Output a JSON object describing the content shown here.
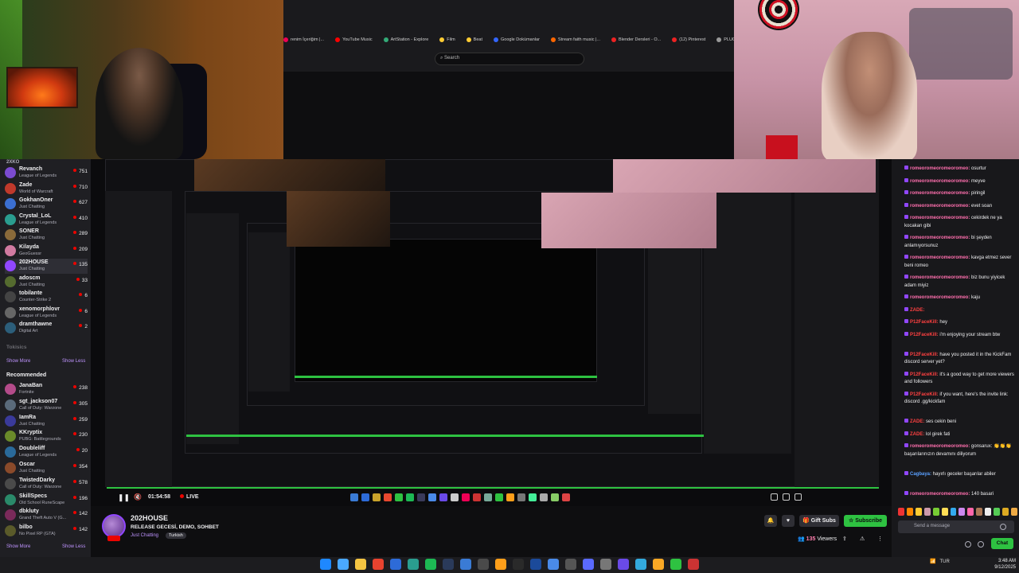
{
  "browser": {
    "bookmarks": [
      "renim İçeriğim |...",
      "YouTube Music",
      "ArtStation - Explore",
      "Film",
      "Beat",
      "Google Dokümanlar",
      "Stream faith music |...",
      "Blender Dersleri - O...",
      "(12) Pinterest",
      "PLUGI"
    ],
    "search_placeholder": "Search"
  },
  "sidebar": {
    "top_label": "2XKO",
    "followed": [
      {
        "name": "Revanch",
        "game": "League of Legends",
        "viewers": "751",
        "color": "#7b4bd0"
      },
      {
        "name": "Zade",
        "game": "World of Warcraft",
        "viewers": "710",
        "color": "#c0392b"
      },
      {
        "name": "GokhanOner",
        "game": "Just Chatting",
        "viewers": "627",
        "color": "#3b6fd1"
      },
      {
        "name": "Crystal_LoL",
        "game": "League of Legends",
        "viewers": "410",
        "color": "#2a9d8f"
      },
      {
        "name": "SONER",
        "game": "Just Chatting",
        "viewers": "289",
        "color": "#8a6a3a"
      },
      {
        "name": "Kilayda",
        "game": "GeoGuessr",
        "viewers": "209",
        "color": "#d17aa0"
      },
      {
        "name": "202HOUSE",
        "game": "Just Chatting",
        "viewers": "135",
        "color": "#9147ff"
      },
      {
        "name": "adoscm",
        "game": "Just Chatting",
        "viewers": "33",
        "color": "#556b2f"
      },
      {
        "name": "tobilante",
        "game": "Counter-Strike 2",
        "viewers": "6",
        "color": "#444"
      },
      {
        "name": "xenomorphlovr",
        "game": "League of Legends",
        "viewers": "6",
        "color": "#666"
      },
      {
        "name": "dramthawne",
        "game": "Digital Art",
        "viewers": "2",
        "color": "#2c5e7a"
      }
    ],
    "offline": "Tokisics",
    "show_more": "Show More",
    "show_less": "Show Less",
    "recommended_title": "Recommended",
    "recommended": [
      {
        "name": "JanaBan",
        "game": "Fortnite",
        "viewers": "238",
        "color": "#b44b8a"
      },
      {
        "name": "sgt_jackson07",
        "game": "Call of Duty: Warzone",
        "viewers": "305",
        "color": "#5a6a7a"
      },
      {
        "name": "IamRa",
        "game": "Just Chatting",
        "viewers": "259",
        "color": "#3a3a9a"
      },
      {
        "name": "KKryptix",
        "game": "PUBG: Battlegrounds",
        "viewers": "230",
        "color": "#6a8a2a"
      },
      {
        "name": "Doubleliff",
        "game": "League of Legends",
        "viewers": "20",
        "color": "#2a6a9a"
      },
      {
        "name": "Oscar",
        "game": "Just Chatting",
        "viewers": "354",
        "color": "#8a4a2a"
      },
      {
        "name": "TwistedDarky",
        "game": "Call of Duty: Warzone",
        "viewers": "578",
        "color": "#4a4a4a"
      },
      {
        "name": "SkillSpecs",
        "game": "Old School RuneScape",
        "viewers": "196",
        "color": "#2a8a6a"
      },
      {
        "name": "dbkluty",
        "game": "Grand Theft Auto V (G...",
        "viewers": "142",
        "color": "#7a2a5a"
      },
      {
        "name": "bilbo",
        "game": "No Pixel RP (GTA)",
        "viewers": "142",
        "color": "#5a5a2a"
      }
    ]
  },
  "player": {
    "time": "01:54:58",
    "live": "LIVE"
  },
  "stream": {
    "streamer": "202HOUSE",
    "title": "RELEASE GECESİ, DEMO, SOHBET",
    "category": "Just Chatting",
    "tag": "Turkish",
    "gift_label": "Gift Subs",
    "subscribe_label": "Subscribe",
    "viewers": "135",
    "viewers_label": "Viewers"
  },
  "chat": {
    "messages": [
      {
        "user": "romeoromeoromeoromeo:",
        "text": " osurtur",
        "cls": ""
      },
      {
        "user": "romeoromeoromeoromeo:",
        "text": " meyve",
        "cls": ""
      },
      {
        "user": "romeoromeoromeoromeo:",
        "text": " piringil",
        "cls": ""
      },
      {
        "user": "romeoromeoromeoromeo:",
        "text": " evet soan",
        "cls": ""
      },
      {
        "user": "romeoromeoromeoromeo:",
        "text": " cekirdek ne ya kocakan gibi",
        "cls": ""
      },
      {
        "user": "romeoromeoromeoromeo:",
        "text": " bi şeyden anlamıyorsunuz",
        "cls": ""
      },
      {
        "user": "romeoromeoromeoromeo:",
        "text": " kavga etmez sever beni romeo",
        "cls": ""
      },
      {
        "user": "romeoromeoromeoromeo:",
        "text": " biz bunu yiyicek adam miyiz",
        "cls": ""
      },
      {
        "user": "romeoromeoromeoromeo:",
        "text": " kaju",
        "cls": ""
      },
      {
        "user": "ZADE:",
        "text": " ",
        "cls": "red"
      },
      {
        "user": "P12FaceKill:",
        "text": " hey",
        "cls": "red"
      },
      {
        "user": "P12FaceKill:",
        "text": " i'm enjoying your stream btw",
        "cls": "red"
      },
      {
        "user": "P12FaceKill:",
        "text": " have you posted it in the KickFam discord server yet?",
        "cls": "red"
      },
      {
        "user": "P12FaceKill:",
        "text": " it's a good way to get more viewers and followers",
        "cls": "red"
      },
      {
        "user": "P12FaceKill:",
        "text": " if you want, here's the invite link: discord .gg/kickfam",
        "cls": "red"
      },
      {
        "user": "ZADE:",
        "text": " ses cekin beni",
        "cls": "red"
      },
      {
        "user": "ZADE:",
        "text": " lol girek fati",
        "cls": "red"
      },
      {
        "user": "romeoromeoromeoromeo:",
        "text": " gonsarux: 👏👏👏 başarılarınızın devamını diliyorum",
        "cls": ""
      },
      {
        "user": "Cagbaya:",
        "text": " hayırlı geceler başarılar abiler",
        "cls": "blue"
      },
      {
        "user": "romeoromeoromeoromeo:",
        "text": " 140 basari",
        "cls": ""
      }
    ],
    "input_placeholder": "Send a message",
    "chat_button": "Chat"
  },
  "taskbar": {
    "lang": "TUR",
    "time": "3:48 AM",
    "date": "9/12/2025"
  }
}
